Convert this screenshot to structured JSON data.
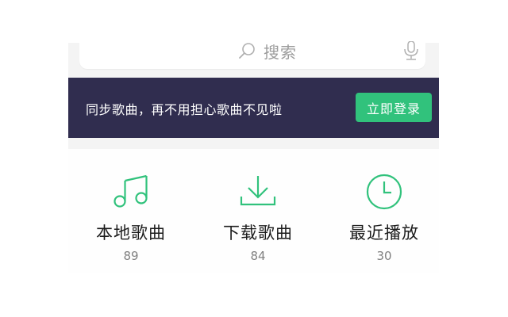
{
  "search": {
    "placeholder": "搜索"
  },
  "banner": {
    "text": "同步歌曲，再不用担心歌曲不见啦",
    "login_label": "立即登录"
  },
  "quick_access": [
    {
      "label": "本地歌曲",
      "count": "89",
      "icon": "music-note-icon"
    },
    {
      "label": "下载歌曲",
      "count": "84",
      "icon": "download-icon"
    },
    {
      "label": "最近播放",
      "count": "30",
      "icon": "clock-icon"
    }
  ],
  "colors": {
    "accent": "#31c27c",
    "banner_bg": "#302d4f",
    "background": "#f4f4f4"
  }
}
